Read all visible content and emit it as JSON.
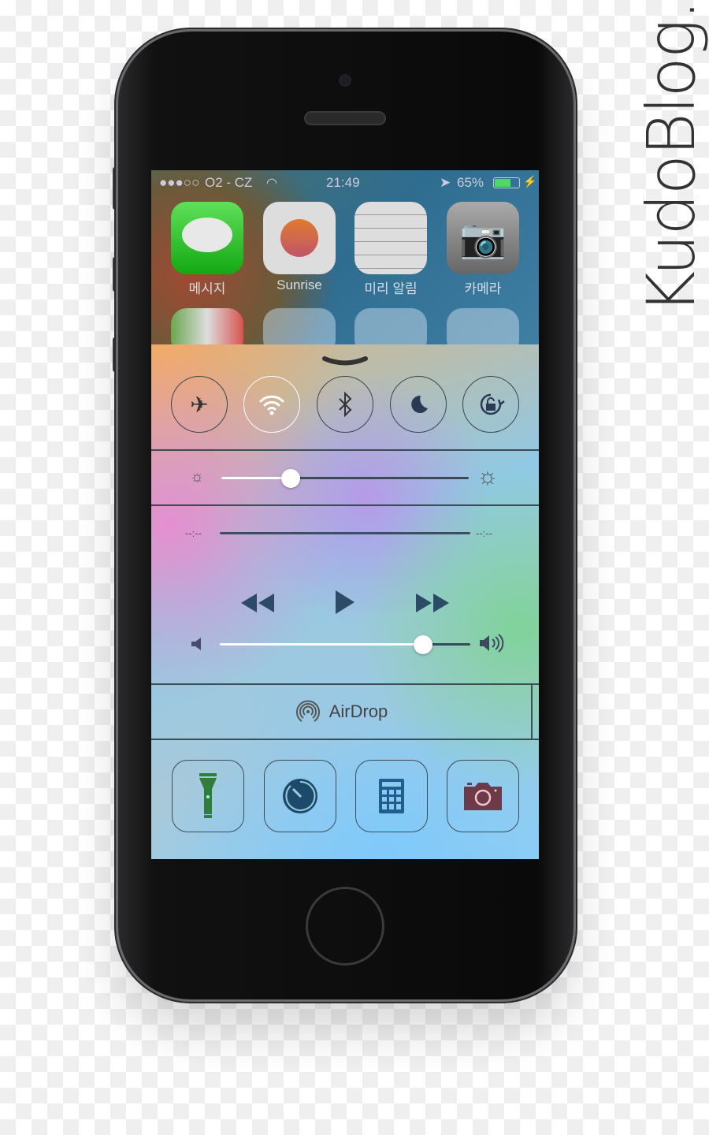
{
  "watermark": "KudoBlog.",
  "status_bar": {
    "signal": "●●●○○",
    "carrier": "O2 - CZ",
    "time": "21:49",
    "battery": "65%",
    "battery_level": 0.65
  },
  "home_apps": [
    {
      "label": "메시지",
      "icon": "messages-icon"
    },
    {
      "label": "Sunrise",
      "icon": "sunrise-calendar-icon"
    },
    {
      "label": "미리 알림",
      "icon": "reminders-icon"
    },
    {
      "label": "카메라",
      "icon": "camera-icon"
    }
  ],
  "control_center": {
    "toggles": [
      {
        "name": "airplane-mode",
        "on": false
      },
      {
        "name": "wifi",
        "on": true
      },
      {
        "name": "bluetooth",
        "on": false
      },
      {
        "name": "do-not-disturb",
        "on": false
      },
      {
        "name": "rotation-lock",
        "on": false
      }
    ],
    "brightness": 0.28,
    "elapsed": "--:--",
    "remaining": "--:--",
    "volume": 0.81,
    "airdrop_label": "AirDrop",
    "shortcuts": [
      "flashlight",
      "timer",
      "calculator",
      "camera"
    ]
  },
  "colors": {
    "wifi_on": "#ffffff",
    "battery": "#4cd964",
    "flashlight": "#2e7d3a",
    "timer": "#1d4a6a",
    "calculator": "#1f5f8f",
    "camera": "#6e3a4a"
  }
}
